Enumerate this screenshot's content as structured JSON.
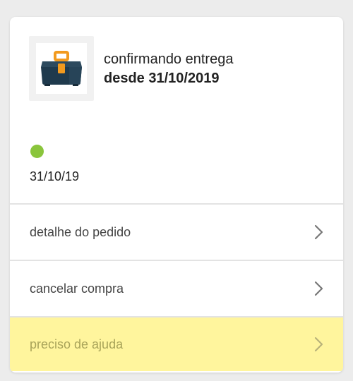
{
  "order": {
    "status_line": "confirmando entrega",
    "status_date": "desde 31/10/2019",
    "thumbnail_icon": "toolbox-icon",
    "status_dot_color": "#8ac53c",
    "date_short": "31/10/19"
  },
  "actions": [
    {
      "label": "detalhe do pedido",
      "icon": "chevron-right-icon"
    },
    {
      "label": "cancelar compra",
      "icon": "chevron-right-icon"
    },
    {
      "label": "preciso de ajuda",
      "icon": "chevron-right-icon",
      "highlight_color": "#fff59d"
    }
  ]
}
